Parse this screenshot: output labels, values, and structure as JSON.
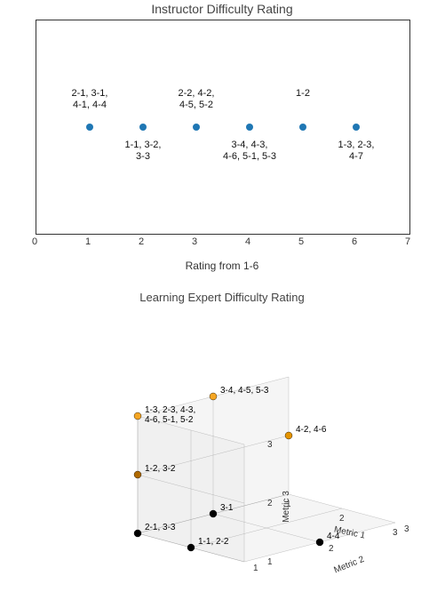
{
  "chart_data": [
    {
      "type": "scatter",
      "title": "Instructor Difficulty Rating",
      "xlabel": "Rating from 1-6",
      "xlim": [
        0,
        7
      ],
      "x": [
        1,
        2,
        3,
        4,
        5,
        6
      ],
      "y": [
        1,
        1,
        1,
        1,
        1,
        1
      ],
      "annotations": [
        {
          "x": 1,
          "pos": "above",
          "text": "2-1, 3-1,\n4-1, 4-4"
        },
        {
          "x": 2,
          "pos": "below",
          "text": "1-1, 3-2,\n3-3"
        },
        {
          "x": 3,
          "pos": "above",
          "text": "2-2, 4-2,\n4-5, 5-2"
        },
        {
          "x": 4,
          "pos": "below",
          "text": "3-4, 4-3,\n4-6, 5-1, 5-3"
        },
        {
          "x": 5,
          "pos": "above",
          "text": "1-2"
        },
        {
          "x": 6,
          "pos": "below",
          "text": "1-3, 2-3,\n4-7"
        }
      ]
    },
    {
      "type": "scatter",
      "title": "Learning Expert Difficulty Rating",
      "axes": {
        "x": "Metric 1",
        "y": "Metric 2",
        "z": "Metric 3"
      },
      "axis_range": {
        "x": [
          1,
          3
        ],
        "y": [
          1,
          3
        ],
        "z": [
          1,
          3
        ]
      },
      "points": [
        {
          "m1": 1,
          "m2": 1,
          "m3": 3,
          "label": "1-3, 2-3, 4-3,\n4-6, 5-1, 5-2",
          "color": "#f5a623"
        },
        {
          "m1": 1,
          "m2": 2,
          "m3": 3,
          "label": "3-4, 4-5, 5-3",
          "color": "#f5a623"
        },
        {
          "m1": 1,
          "m2": 3,
          "m3": 2,
          "label": "4-2, 4-6",
          "color": "#e59400"
        },
        {
          "m1": 1,
          "m2": 1,
          "m3": 2,
          "label": "1-2, 3-2",
          "color": "#b06a00"
        },
        {
          "m1": 1,
          "m2": 1,
          "m3": 1,
          "label": "2-1, 3-3",
          "color": "#000"
        },
        {
          "m1": 2,
          "m2": 1,
          "m3": 1,
          "label": "1-1, 2-2",
          "color": "#000"
        },
        {
          "m1": 1,
          "m2": 2,
          "m3": 1,
          "label": "3-1",
          "color": "#000"
        },
        {
          "m1": 3,
          "m2": 2,
          "m3": 1,
          "label": "4-4",
          "color": "#000"
        }
      ]
    }
  ]
}
